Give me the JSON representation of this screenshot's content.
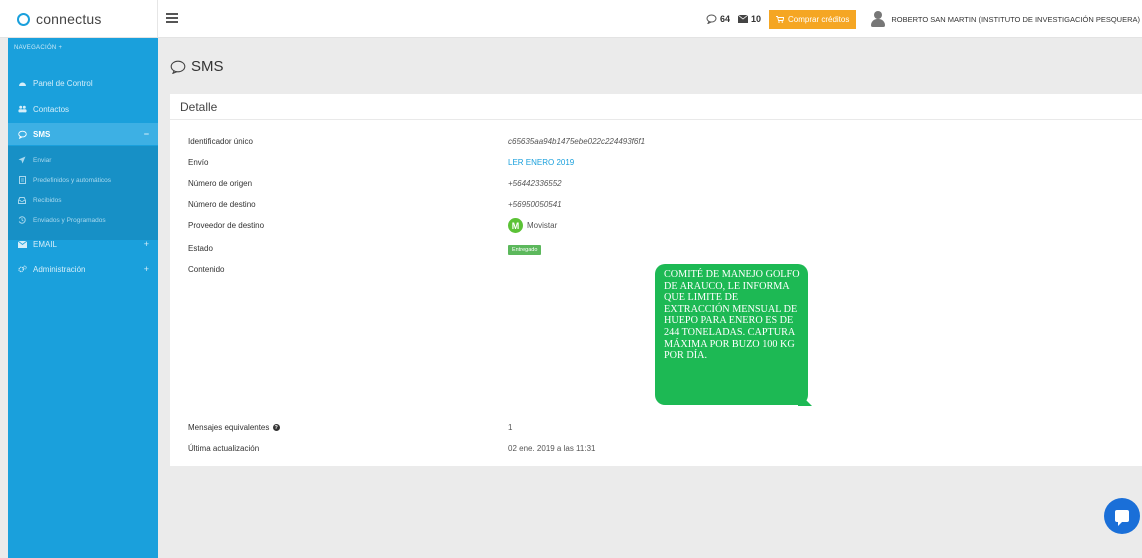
{
  "brand": {
    "name": "connectus"
  },
  "topbar": {
    "messages_count": "64",
    "mail_count": "10",
    "buy_label": "Comprar créditos",
    "user_name": "ROBERTO SAN MARTIN (INSTITUTO DE INVESTIGACIÓN PESQUERA)"
  },
  "sidebar": {
    "header": "NAVEGACIÓN +",
    "items": [
      {
        "label": "Panel de Control",
        "icon": "dashboard-icon"
      },
      {
        "label": "Contactos",
        "icon": "users-icon"
      },
      {
        "label": "SMS",
        "icon": "chat-icon",
        "toggle": "−"
      },
      {
        "label": "EMAIL",
        "icon": "mail-icon",
        "toggle": "+"
      },
      {
        "label": "Administración",
        "icon": "cogs-icon",
        "toggle": "+"
      }
    ],
    "sms_sub": [
      {
        "label": "Enviar",
        "icon": "send-icon"
      },
      {
        "label": "Predefinidos y automáticos",
        "icon": "document-icon"
      },
      {
        "label": "Recibidos",
        "icon": "inbox-icon"
      },
      {
        "label": "Enviados y Programados",
        "icon": "history-icon"
      }
    ]
  },
  "page": {
    "title": "SMS"
  },
  "detail": {
    "title": "Detalle",
    "rows": {
      "id": {
        "label": "Identificador único",
        "value": "c65635aa94b1475ebe022c224493f6f1"
      },
      "envio": {
        "label": "Envío",
        "value": "LER ENERO 2019"
      },
      "origen": {
        "label": "Número de origen",
        "value": "+56442336552"
      },
      "destino": {
        "label": "Número de destino",
        "value": "+56950050541"
      },
      "proveedor": {
        "label": "Proveedor de destino",
        "value": "Movistar",
        "logo_letter": "M"
      },
      "estado": {
        "label": "Estado",
        "value": "Entregado"
      },
      "contenido": {
        "label": "Contenido"
      },
      "equivalentes": {
        "label": "Mensajes equivalentes",
        "info": "?",
        "value": "1"
      },
      "actualizacion": {
        "label": "Última actualización",
        "value": "02 ene. 2019 a las 11:31"
      }
    },
    "message": "COMITÉ DE MANEJO GOLFO DE ARAUCO, LE INFORMA QUE LIMITE DE EXTRACCIÓN MENSUAL DE HUEPO PARA ENERO ES DE 244 TONELADAS. CAPTURA MÁXIMA POR BUZO 100 KG POR DÍA."
  },
  "colors": {
    "sidebar": "#1aa0dc",
    "accent": "#f5a623",
    "bubble": "#1db954",
    "status": "#5cb85c"
  }
}
